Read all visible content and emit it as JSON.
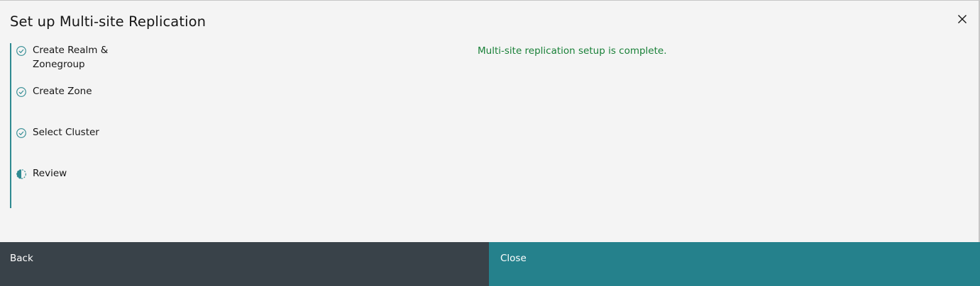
{
  "modal": {
    "title": "Set up Multi-site Replication",
    "close_icon": "close-icon"
  },
  "steps": [
    {
      "label": "Create Realm & Zonegroup",
      "status": "complete",
      "icon": "checkmark-outline-icon"
    },
    {
      "label": "Create Zone",
      "status": "complete",
      "icon": "checkmark-outline-icon"
    },
    {
      "label": "Select Cluster",
      "status": "complete",
      "icon": "checkmark-outline-icon"
    },
    {
      "label": "Review",
      "status": "current",
      "icon": "incomplete-icon"
    }
  ],
  "message": {
    "text": "Multi-site replication setup is complete.",
    "color": "#198038"
  },
  "footer": {
    "back_label": "Back",
    "close_label": "Close"
  },
  "colors": {
    "accent": "#2f8a91",
    "back_button": "#394249",
    "close_button": "#25818c",
    "background": "#f4f4f4"
  }
}
